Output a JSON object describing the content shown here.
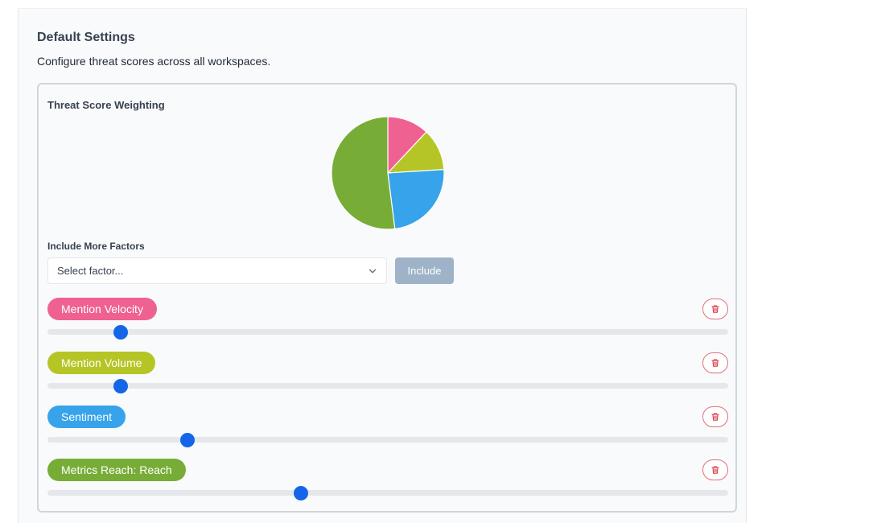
{
  "header": {
    "title": "Default Settings",
    "subtitle": "Configure threat scores across all workspaces."
  },
  "card": {
    "title": "Threat Score Weighting"
  },
  "chart_data": {
    "type": "pie",
    "labels": [
      "Mention Velocity",
      "Mention Volume",
      "Sentiment",
      "Metrics Reach: Reach"
    ],
    "values": [
      12,
      12,
      24,
      52
    ],
    "colors": [
      "#ef6191",
      "#b5c526",
      "#36a3ea",
      "#77ad37"
    ]
  },
  "include_section": {
    "label": "Include More Factors",
    "select_placeholder": "Select factor...",
    "include_button": "Include"
  },
  "factors": [
    {
      "label": "Mention Velocity",
      "color": "#ef6191",
      "value": 0.108
    },
    {
      "label": "Mention Volume",
      "color": "#b5c526",
      "value": 0.108
    },
    {
      "label": "Sentiment",
      "color": "#36a3ea",
      "value": 0.206
    },
    {
      "label": "Metrics Reach: Reach",
      "color": "#77ad37",
      "value": 0.372
    }
  ],
  "icons": {
    "delete": "trash-icon",
    "select_arrow": "chevron-down-icon"
  }
}
